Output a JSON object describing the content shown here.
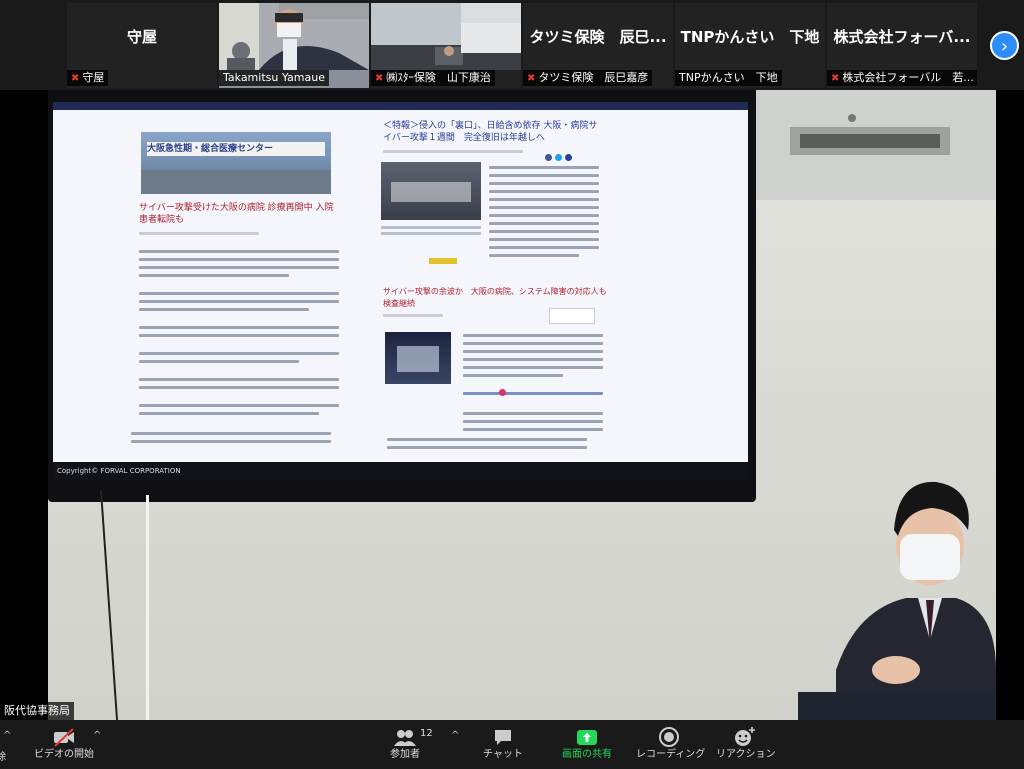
{
  "participants": [
    {
      "big_name": "守屋",
      "caption": "守屋",
      "muted": true,
      "video": false
    },
    {
      "big_name": "",
      "caption": "Takamitsu Yamaue",
      "muted": false,
      "video": true
    },
    {
      "big_name": "",
      "caption": "㈱ｽﾀｰ保険　山下康治",
      "muted": true,
      "video": true
    },
    {
      "big_name": "タツミ保険　辰巳...",
      "caption": "タツミ保険　辰巳嘉彦",
      "muted": true,
      "video": false
    },
    {
      "big_name": "TNPかんさい　下地",
      "caption": "TNPかんさい　下地",
      "muted": false,
      "video": false
    },
    {
      "big_name": "株式会社フォーバ...",
      "caption": "株式会社フォーバル　若...",
      "muted": true,
      "video": false
    }
  ],
  "main_speaker_name": "阪代協事務局",
  "screen_content": {
    "left_headline": "サイバー攻撃受けた大阪の病院 診療再開中 入院患者転院も",
    "right_headline": "＜特報＞侵入の「裏口」、日給含め依存 大阪・病院サイバー攻撃１週間　完全復旧は年越しへ",
    "mid_headline": "サイバー攻撃の余波か　大阪の病院、システム障害の対応人も検査継続",
    "sign_text": "大阪急性期・総合医療センター",
    "copyright": "Copyright© FORVAL CORPORATION"
  },
  "toolbar": {
    "unmute_label": "除",
    "video_label": "ビデオの開始",
    "participants_label": "参加者",
    "participants_count": "12",
    "chat_label": "チャット",
    "share_label": "画面の共有",
    "record_label": "レコーディング",
    "reaction_label": "リアクション"
  },
  "colors": {
    "share_green": "#23d959",
    "mute_red": "#e53935",
    "accent_blue": "#2d8cff",
    "bg_dark": "#1a1a1a"
  }
}
